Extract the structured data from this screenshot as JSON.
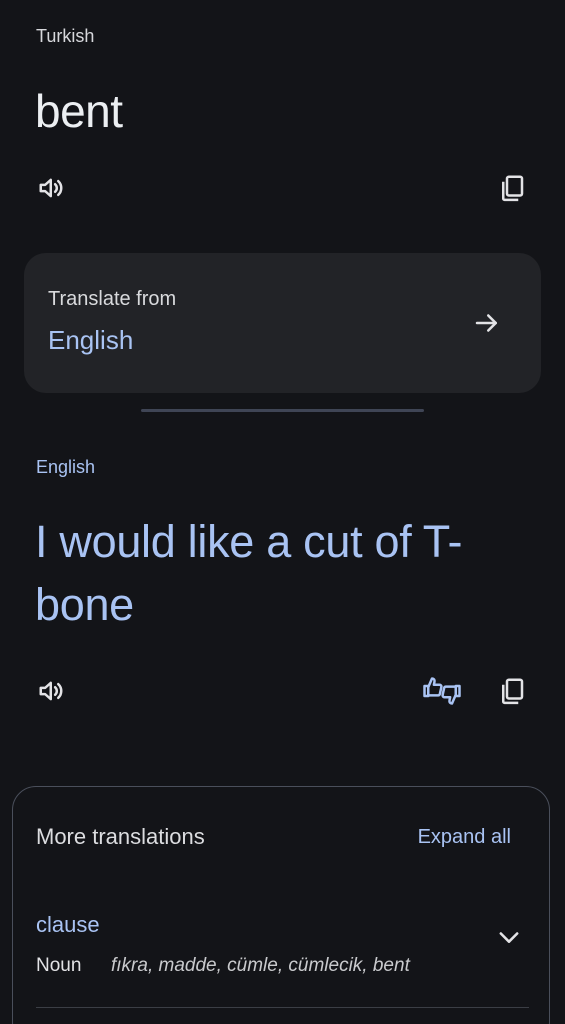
{
  "source": {
    "language": "Turkish",
    "text": "bent"
  },
  "translate_from": {
    "label": "Translate from",
    "language": "English"
  },
  "target": {
    "language": "English",
    "text": "I would like a cut of T-bone"
  },
  "more_translations": {
    "title": "More translations",
    "expand_label": "Expand all",
    "entries": [
      {
        "word": "clause",
        "part_of_speech": "Noun",
        "synonyms": "fıkra, madde, cümle, cümlecik, bent"
      }
    ]
  },
  "icons": {
    "speaker": "speaker-icon",
    "copy": "copy-icon",
    "arrow": "arrow-right-icon",
    "feedback": "thumbs-feedback-icon",
    "chevron": "chevron-down-icon"
  },
  "colors": {
    "background": "#131418",
    "card": "#222327",
    "accent": "#a9c3f3",
    "text": "#e3e3e6"
  }
}
